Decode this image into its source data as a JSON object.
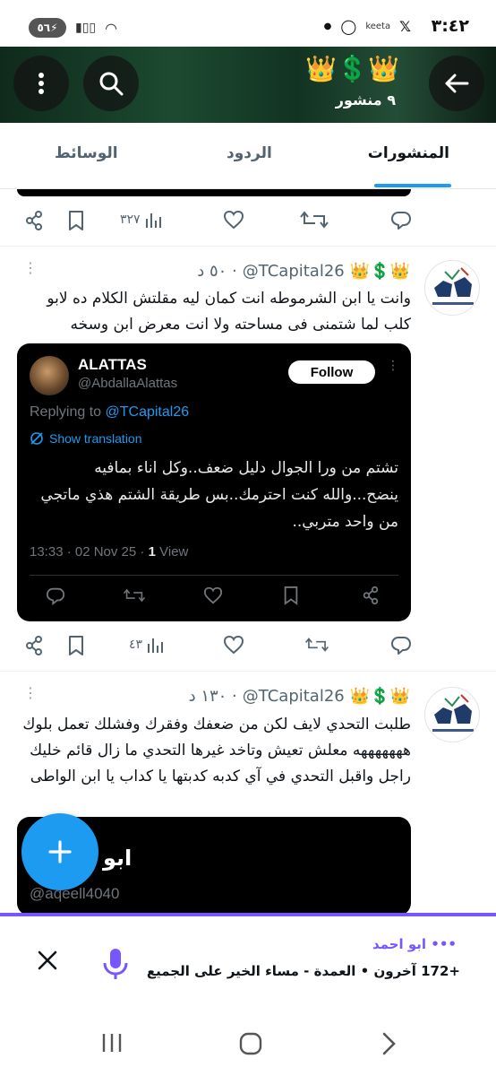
{
  "status_bar": {
    "time": "٣:٤٢",
    "battery": "٥٦",
    "notification_label": "keeta"
  },
  "header": {
    "title_emojis": "👑💲👑",
    "subtitle": "٩ منشور"
  },
  "tabs": [
    {
      "label": "المنشورات",
      "active": true
    },
    {
      "label": "الردود",
      "active": false
    },
    {
      "label": "الوسائط",
      "active": false
    }
  ],
  "top_action_bar": {
    "views": "٣٢٧"
  },
  "tweets": [
    {
      "author": "@TCapital26",
      "emojis": "👑💲👑",
      "time": "٥٠ د",
      "text": "وانت يا ابن الشرموطه انت كمان ليه مقلتش الكلام ده لابو كلب لما شتمنى فى مساحته ولا انت معرض ابن وسخه",
      "quoted": {
        "name": "ALATTAS",
        "handle": "@AbdallaAlattas",
        "follow_label": "Follow",
        "replying_prefix": "Replying to",
        "replying_handle": "@TCapital26",
        "translate_label": "Show translation",
        "text": "تشتم من ورا الجوال دليل ضعف..وكل اناء بمافيه ينضح...والله كنت احترمك..بس طريقة الشتم هذي ماتجي من واحد متربي..",
        "meta_date": "13:33 · 02 Nov 25 · ",
        "meta_views_count": "1",
        "meta_views_label": "View"
      },
      "views": "٤٣"
    },
    {
      "author": "@TCapital26",
      "emojis": "👑💲👑",
      "time": "١٣٠ د",
      "text": "طلبت التحدي لايف لكن من ضعفك وفقرك وفشلك تعمل بلوك هههههههه معلش تعيش وتاخد غيرها التحدي ما زال قائم خليك راجل واقبل التحدي في آي كدبه كدبتها يا كداب يا ابن الواطى",
      "quoted": {
        "name": "ابو",
        "handle": "@aqeell4040"
      }
    }
  ],
  "spaces_bar": {
    "title": "••• ابو احمد",
    "subtitle": "+172 آخرون • العمدة - مساء الخير على الجميع"
  },
  "colors": {
    "accent": "#1d9bf0",
    "spaces": "#7856ff",
    "muted": "#536471"
  }
}
